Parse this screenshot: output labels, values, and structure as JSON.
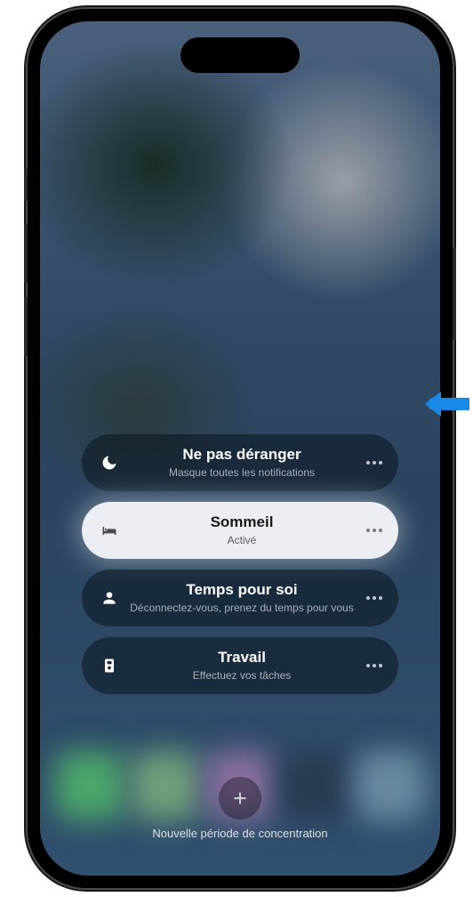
{
  "focus_items": [
    {
      "id": "dnd",
      "title": "Ne pas déranger",
      "subtitle": "Masque toutes les notifications",
      "icon": "moon-icon",
      "active": false
    },
    {
      "id": "sleep",
      "title": "Sommeil",
      "subtitle": "Activé",
      "icon": "bed-icon",
      "active": true
    },
    {
      "id": "personal",
      "title": "Temps pour soi",
      "subtitle": "Déconnectez-vous, prenez du temps pour vous",
      "icon": "person-icon",
      "active": false
    },
    {
      "id": "work",
      "title": "Travail",
      "subtitle": "Effectuez vos tâches",
      "icon": "badge-icon",
      "active": false
    }
  ],
  "new_focus_label": "Nouvelle période de concentration",
  "annotation_arrow_color": "#1988e6"
}
